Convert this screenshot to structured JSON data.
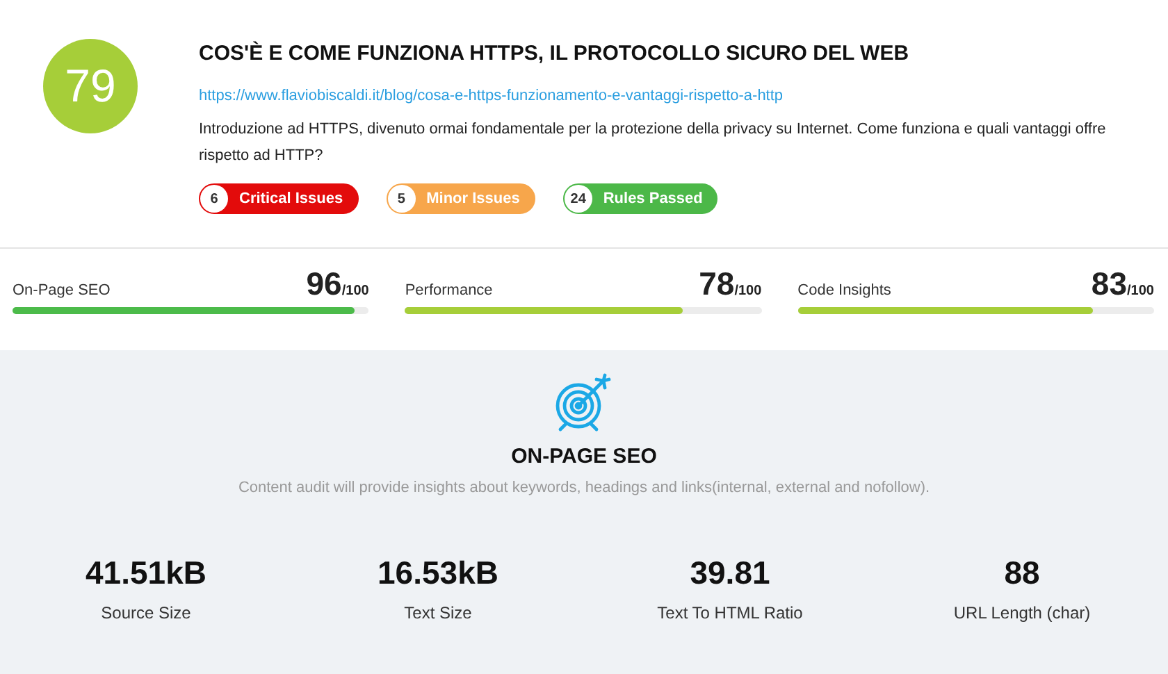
{
  "header": {
    "score": "79",
    "title": "COS'È E COME FUNZIONA HTTPS, IL PROTOCOLLO SICURO DEL WEB",
    "url": "https://www.flaviobiscaldi.it/blog/cosa-e-https-funzionamento-e-vantaggi-rispetto-a-http",
    "description": "Introduzione ad HTTPS, divenuto ormai fondamentale per la protezione della privacy su Internet. Come funziona e quali vantaggi offre rispetto ad HTTP?",
    "badges": [
      {
        "count": "6",
        "label": "Critical Issues",
        "color": "#e30b0b"
      },
      {
        "count": "5",
        "label": "Minor Issues",
        "color": "#f7a64b"
      },
      {
        "count": "24",
        "label": "Rules Passed",
        "color": "#4cb848"
      }
    ]
  },
  "scores": [
    {
      "name": "On-Page SEO",
      "value": "96",
      "max": "/100",
      "level": 0.96,
      "color": "#4cbb4a"
    },
    {
      "name": "Performance",
      "value": "78",
      "max": "/100",
      "level": 0.78,
      "color": "#a6ce39"
    },
    {
      "name": "Code Insights",
      "value": "83",
      "max": "/100",
      "level": 0.83,
      "color": "#a6ce39"
    }
  ],
  "section": {
    "title": "ON-PAGE SEO",
    "description": "Content audit will provide insights about keywords, headings and links(internal, external and nofollow)."
  },
  "stats": [
    {
      "value": "41.51kB",
      "label": "Source Size"
    },
    {
      "value": "16.53kB",
      "label": "Text Size"
    },
    {
      "value": "39.81",
      "label": "Text To HTML Ratio"
    },
    {
      "value": "88",
      "label": "URL Length (char)"
    }
  ]
}
